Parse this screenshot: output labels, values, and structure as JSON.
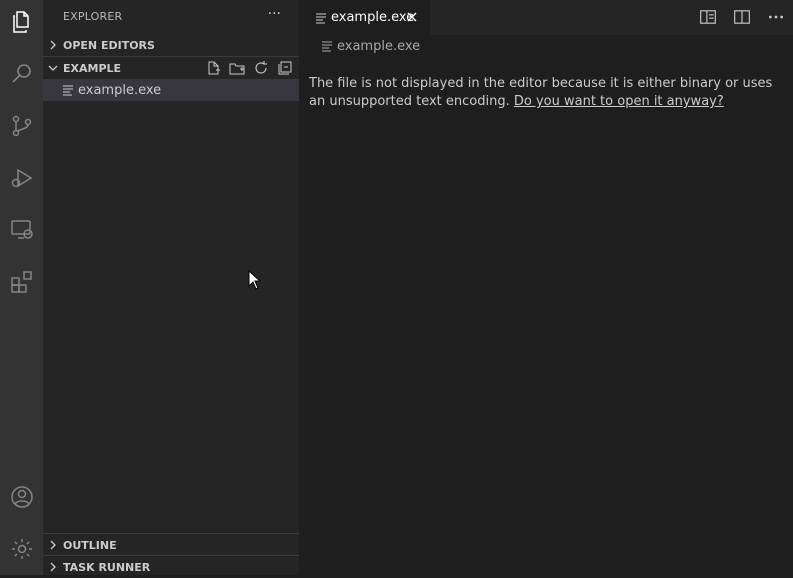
{
  "activitybar": {
    "items": [
      "explorer-icon",
      "search-icon",
      "source-control-icon",
      "run-debug-icon",
      "remote-explorer-icon",
      "extensions-icon"
    ],
    "bottom": [
      "account-icon",
      "settings-gear-icon"
    ]
  },
  "sidebar": {
    "title": "EXPLORER",
    "more": "···",
    "sections": {
      "open_editors": "OPEN EDITORS",
      "example": "EXAMPLE",
      "outline": "OUTLINE",
      "task_runner": "TASK RUNNER"
    },
    "files": [
      {
        "name": "example.exe"
      }
    ]
  },
  "editor": {
    "tab_label": "example.exe",
    "breadcrumb": "example.exe",
    "message_text": "The file is not displayed in the editor because it is either binary or uses an unsupported text encoding.",
    "message_link": "Do you want to open it anyway?"
  },
  "colors": {
    "activitybar": "#333333",
    "sidebar": "#252526",
    "editor": "#1e1e1e",
    "selected_row": "#37373d"
  }
}
